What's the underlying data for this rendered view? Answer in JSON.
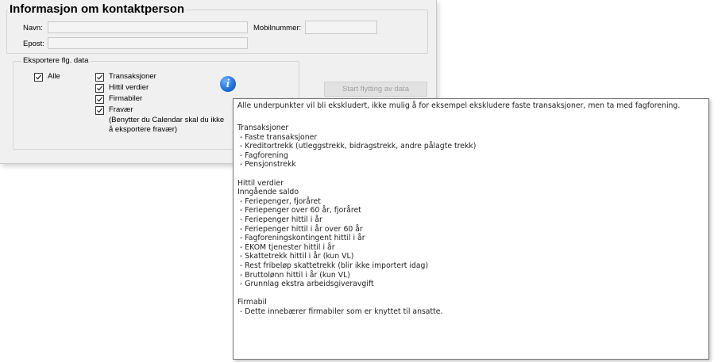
{
  "contact": {
    "title": "Informasjon om kontaktperson",
    "navn_label": "Navn:",
    "navn_value": "",
    "mobil_label": "Mobilnummer:",
    "mobil_value": "",
    "epost_label": "Epost:",
    "epost_value": ""
  },
  "export": {
    "title": "Eksportere flg. data",
    "all_label": "Alle",
    "items": [
      {
        "label": "Transaksjoner",
        "checked": true
      },
      {
        "label": "Hittil verdier",
        "checked": true
      },
      {
        "label": "Firmabiler",
        "checked": true
      },
      {
        "label": "Fravær",
        "checked": true
      }
    ],
    "fravaer_note": "(Benytter du Calendar skal du ikke\nå eksportere fravær)",
    "info_icon": "info-icon"
  },
  "start_button": "Start flytting av data",
  "tooltip": {
    "first_line": "Alle underpunkter vil bli ekskludert, ikke mulig å for eksempel ekskludere faste transaksjoner, men ta med fagforening.",
    "body": "Transaksjoner\n - Faste transaksjoner\n - Kreditortrekk (utleggstrekk, bidragstrekk, andre pålagte trekk)\n - Fagforening\n - Pensjonstrekk\n\nHittil verdier\nInngående saldo\n - Feriepenger, fjoråret\n - Feriepenger over 60 år, fjoråret\n - Feriepenger hittil i år\n - Feriepenger hittil i år over 60 år\n - Fagforeningskontingent hittil i år\n - EKOM tjenester hittil i år\n - Skattetrekk hittil i år (kun VL)\n - Rest fribeløp skattetrekk (blir ikke importert idag)\n - Bruttolønn hittil i år (kun VL)\n - Grunnlag ekstra arbeidsgiveravgift\n\nFirmabil\n - Dette innebærer firmabiler som er knyttet til ansatte."
  }
}
